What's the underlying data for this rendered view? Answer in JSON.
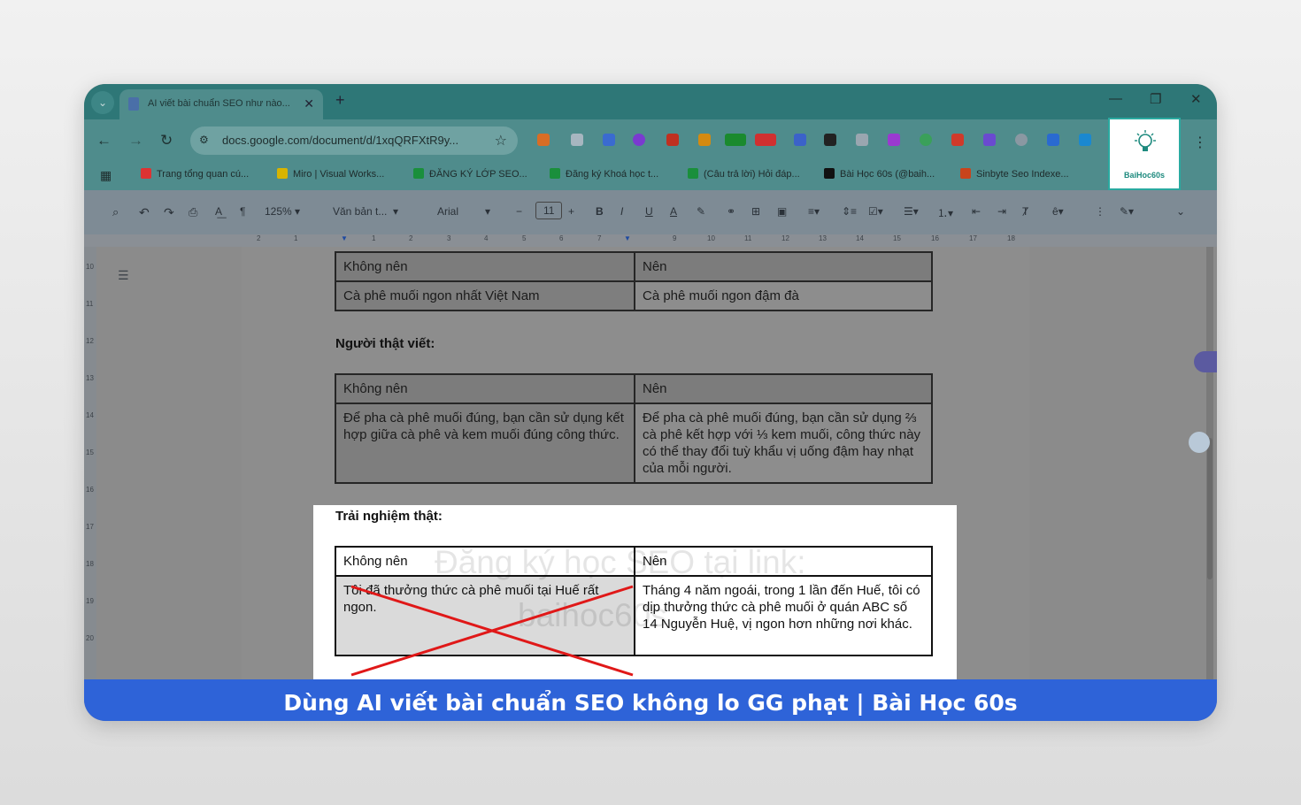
{
  "browser": {
    "tab_title": "AI viết bài chuẩn SEO như nào...",
    "url": "docs.google.com/document/d/1xqQRFXtR9y...",
    "bookmarks": [
      {
        "label": "Trang tổng quan cú...",
        "color": "#d33"
      },
      {
        "label": "Miro | Visual Works...",
        "color": "#d8b400"
      },
      {
        "label": "ĐĂNG KÝ LỚP SEO...",
        "color": "#1a8f3c"
      },
      {
        "label": "Đăng ký Khoá học t...",
        "color": "#1a8f3c"
      },
      {
        "label": "(Câu trả lời) Hỏi đáp...",
        "color": "#1a8f3c"
      },
      {
        "label": "Bài Học 60s (@baih...",
        "color": "#111"
      },
      {
        "label": "Sinbyte Seo Indexe...",
        "color": "#c8441c"
      }
    ],
    "logo_text": "BaiHoc60s"
  },
  "toolbar": {
    "zoom": "125%",
    "style": "Văn bản t...",
    "font": "Arial",
    "font_size": "11"
  },
  "document": {
    "table1": {
      "headers": [
        "Không nên",
        "Nên"
      ],
      "row": [
        "Cà phê muối ngon nhất Việt Nam",
        "Cà phê muối ngon đậm đà"
      ]
    },
    "heading2": "Người thật viết:",
    "table2": {
      "headers": [
        "Không nên",
        "Nên"
      ],
      "row": [
        "Để pha cà phê muối đúng, bạn cần sử dụng kết hợp giữa cà phê và kem muối đúng công thức.",
        "Để pha cà phê muối đúng, bạn cần sử dụng ⅔ cà phê kết hợp với ⅓ kem muối, công thức này có thể thay đổi tuỳ khẩu vị uống đậm hay nhạt của mỗi người."
      ]
    },
    "heading3": "Trải nghiệm thật:",
    "table3": {
      "headers": [
        "Không nên",
        "Nên"
      ],
      "row": [
        "Tôi đã thưởng thức cà phê muối tại Huế rất ngon.",
        "Tháng 4 năm ngoái, trong 1 lần đến Huế, tôi có dịp thưởng thức cà phê muối ở quán ABC số 14 Nguyễn Huệ, vị ngon hơn những nơi khác."
      ]
    },
    "watermark_line1": "Đăng ký học SEO tại link:",
    "watermark_line2": "baihoc60s"
  },
  "caption": "Dùng AI viết bài chuẩn SEO không lo GG phạt | Bài Học 60s"
}
